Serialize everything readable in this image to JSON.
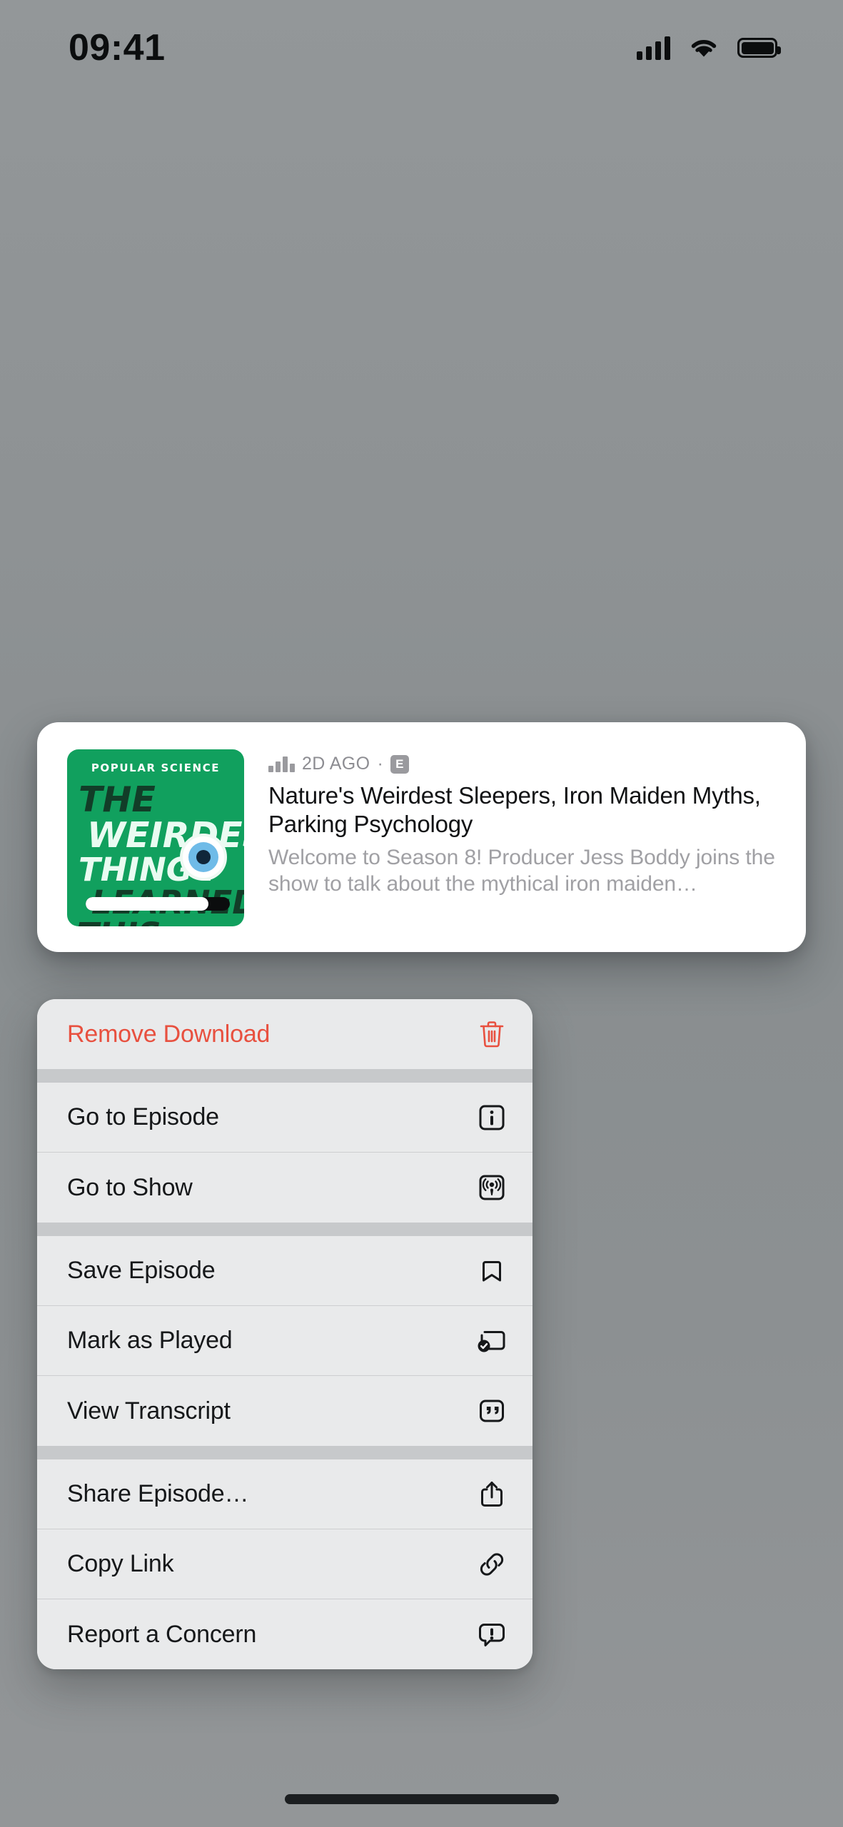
{
  "status_bar": {
    "time": "09:41",
    "signal_icon": "cellular-bars-icon",
    "wifi_icon": "wifi-icon",
    "battery_icon": "battery-full-icon"
  },
  "episode_card": {
    "artwork": {
      "brand": "POPULAR SCIENCE",
      "title_lines": [
        "THE",
        "WEIRDEST",
        "THING I",
        "LEARNED",
        "THIS WEEK"
      ],
      "background_color": "#11a05e",
      "eye_icon": "eyeball-icon",
      "progress_percent": 85
    },
    "meta": {
      "now_playing_icon": "audio-bars-icon",
      "date": "2D AGO",
      "separator": "·",
      "explicit_badge": "E"
    },
    "title": "Nature's Weirdest Sleepers, Iron Maiden Myths, Parking Psychology",
    "description": "Welcome to Season 8! Producer Jess Boddy joins the show to talk about the mythical iron maiden…"
  },
  "context_menu": {
    "destructive_color": "#e8503f",
    "groups": [
      {
        "items": [
          {
            "label": "Remove Download",
            "icon": "trash-icon",
            "destructive": true
          }
        ]
      },
      {
        "items": [
          {
            "label": "Go to Episode",
            "icon": "info-square-icon",
            "destructive": false
          },
          {
            "label": "Go to Show",
            "icon": "podcast-square-icon",
            "destructive": false
          }
        ]
      },
      {
        "items": [
          {
            "label": "Save Episode",
            "icon": "bookmark-icon",
            "destructive": false
          },
          {
            "label": "Mark as Played",
            "icon": "rectangle-badge-checkmark-icon",
            "destructive": false
          },
          {
            "label": "View Transcript",
            "icon": "quote-bubble-icon",
            "destructive": false
          }
        ]
      },
      {
        "items": [
          {
            "label": "Share Episode…",
            "icon": "share-icon",
            "destructive": false
          },
          {
            "label": "Copy Link",
            "icon": "link-icon",
            "destructive": false
          },
          {
            "label": "Report a Concern",
            "icon": "exclamation-bubble-icon",
            "destructive": false
          }
        ]
      }
    ]
  },
  "home_indicator": "home-indicator"
}
